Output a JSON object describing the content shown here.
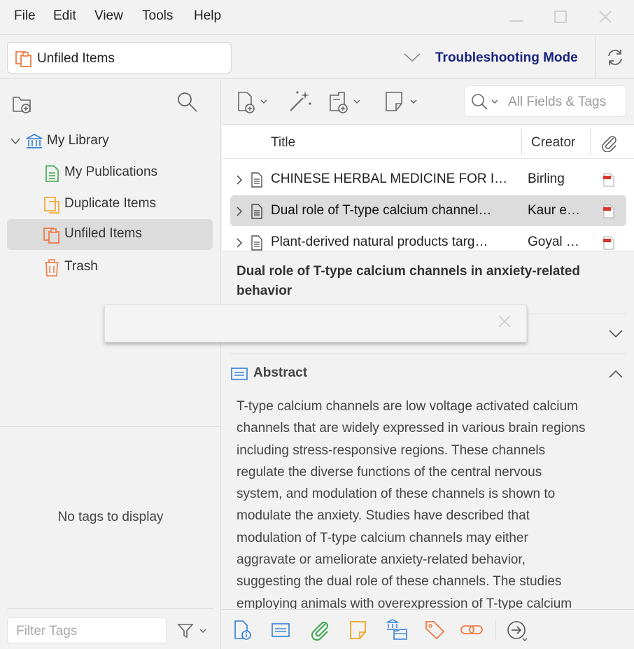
{
  "menu": [
    "File",
    "Edit",
    "View",
    "Tools",
    "Help"
  ],
  "collection_selector": {
    "label": "Unfiled Items"
  },
  "troubleshooting_label": "Troubleshooting Mode",
  "library": {
    "root": "My Library",
    "items": [
      {
        "label": "My Publications",
        "icon": "publications-icon",
        "color": "#3aa84b"
      },
      {
        "label": "Duplicate Items",
        "icon": "duplicate-icon",
        "color": "#f0a21c"
      },
      {
        "label": "Unfiled Items",
        "icon": "unfiled-icon",
        "color": "#ef7b45",
        "selected": true
      },
      {
        "label": "Trash",
        "icon": "trash-icon",
        "color": "#ef7b45"
      }
    ]
  },
  "tags": {
    "empty_text": "No tags to display",
    "filter_placeholder": "Filter Tags"
  },
  "search": {
    "placeholder": "All Fields & Tags"
  },
  "columns": {
    "title": "Title",
    "creator": "Creator"
  },
  "rows": [
    {
      "title": "CHINESE HERBAL MEDICINE FOR I…",
      "creator": "Birling",
      "selected": false
    },
    {
      "title": "Dual role of T-type calcium channel…",
      "creator": "Kaur e…",
      "selected": true
    },
    {
      "title": "Plant-derived natural products targ…",
      "creator": "Goyal …",
      "selected": false
    }
  ],
  "item": {
    "title": "Dual role of T-type calcium channels in anxiety-related behavior",
    "abstract_heading": "Abstract",
    "abstract_lines": [
      "T-type calcium channels are low voltage activated calcium",
      "channels that are widely expressed in various brain regions",
      "including stress-responsive regions. These channels",
      "regulate the diverse functions of the central nervous",
      "system, and modulation of these channels is shown to",
      "modulate the anxiety. Studies have described that",
      "modulation of T-type calcium channels may either",
      "aggravate or ameliorate anxiety-related behavior,",
      "suggesting the dual role of these channels. The studies",
      "employing animals with overexpression of T-type calcium"
    ]
  },
  "colors": {
    "accent_orange": "#ef7b45",
    "accent_blue": "#2f7ed8",
    "accent_green": "#3aa84b",
    "accent_yellow": "#f0a21c",
    "troubleshoot_text": "#1a237e"
  }
}
